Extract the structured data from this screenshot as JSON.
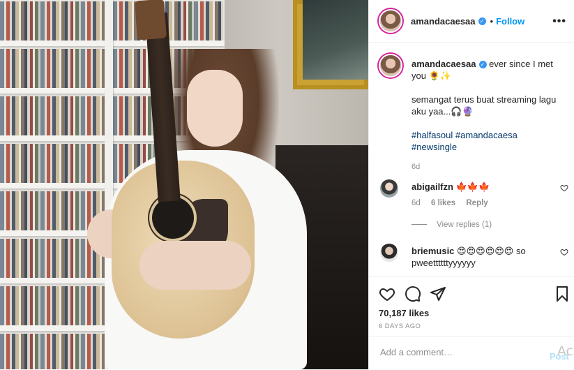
{
  "post": {
    "username": "amandacaesaa",
    "follow_label": "Follow",
    "dot": "•",
    "more_glyph": "•••"
  },
  "caption": {
    "username": "amandacaesaa",
    "line1": "ever since I met you 🌻✨",
    "line2": "semangat terus buat streaming lagu aku yaa...🎧🔮",
    "hashtag1": "#halfasoul",
    "hashtag2": "#amandacaesa",
    "hashtag3": "#newsingle",
    "time": "6d"
  },
  "comments": [
    {
      "username": "abigailfzn",
      "text": "🍁🍁🍁",
      "time": "6d",
      "likes": "6 likes",
      "reply": "Reply",
      "view_replies": "View replies (1)"
    },
    {
      "username": "briemusic",
      "text": "😍😍😍😍😍😍 so pweettttttyyyyyy"
    }
  ],
  "actions": {
    "likes": "70,187 likes",
    "ago": "6 DAYS AGO"
  },
  "composer": {
    "placeholder": "Add a comment…",
    "post_label": "Post",
    "watermark": "Ac"
  },
  "colors": {
    "link_blue": "#0095f6",
    "verified_blue": "#3897f0",
    "hashtag": "#00376b",
    "muted": "#8e8e8e"
  }
}
